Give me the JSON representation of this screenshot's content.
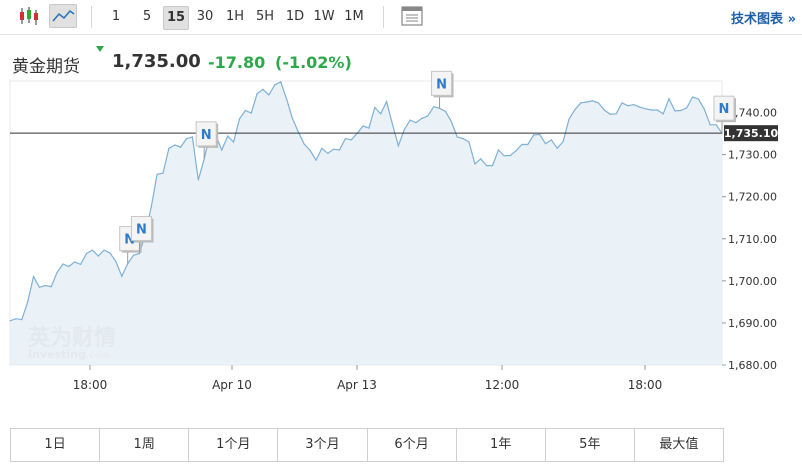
{
  "toolbar": {
    "intervals": [
      "1",
      "5",
      "15",
      "30",
      "1H",
      "5H",
      "1D",
      "1W",
      "1M"
    ],
    "active_interval": "15",
    "tech_chart_label": "技术图表",
    "tech_chart_arrow": "»"
  },
  "header": {
    "name": "黄金期货",
    "price": "1,735.00",
    "change": "-17.80",
    "change_pct": "(-1.02%)",
    "change_color": "#2da94a"
  },
  "watermark": {
    "cn": "英为财情",
    "en": "Investing",
    "suffix": ".com"
  },
  "range_buttons": [
    "1日",
    "1周",
    "1个月",
    "3个月",
    "6个月",
    "1年",
    "5年",
    "最大值"
  ],
  "chart_data": {
    "type": "area",
    "x_tick_labels": [
      "18:00",
      "Apr 10",
      "Apr 13",
      "12:00",
      "18:00"
    ],
    "y_ticks": [
      1680,
      1690,
      1700,
      1710,
      1720,
      1730,
      1740
    ],
    "y_tick_labels": [
      "1,680.00",
      "1,690.00",
      "1,700.00",
      "1,710.00",
      "1,720.00",
      "1,730.00",
      "1,740.00"
    ],
    "ylim": [
      1680,
      1747.5
    ],
    "current_price": 1735.1,
    "current_price_label": "1,735.10",
    "line_color": "#7eb1d7",
    "fill_color": "#e6eff6",
    "series": [
      {
        "values": [
          1690.5,
          1691,
          1690.8,
          1695,
          1701,
          1698.5,
          1698.9,
          1698.6,
          1702,
          1704,
          1703.4,
          1704.5,
          1703.9,
          1706.5,
          1707.3,
          1705.9,
          1707.3,
          1706.6,
          1704.6,
          1701.1,
          1704.1,
          1706.1,
          1706.5,
          1711.1,
          1717.5,
          1725.3,
          1725.6,
          1731.5,
          1732.3,
          1731.8,
          1733.8,
          1734.2,
          1724,
          1729,
          1735.1,
          1734.4,
          1731.1,
          1734.4,
          1733,
          1738.5,
          1740.5,
          1739.9,
          1744.5,
          1745.5,
          1744.2,
          1746.6,
          1747.3,
          1743.2,
          1738.6,
          1735.4,
          1732.5,
          1731,
          1728.7,
          1731.5,
          1730.3,
          1731.3,
          1731.1,
          1733.8,
          1733.5,
          1735.1,
          1736.8,
          1736.3,
          1741.2,
          1739.7,
          1742.6,
          1737.2,
          1732.1,
          1735.9,
          1738.2,
          1737.6,
          1738.6,
          1739.2,
          1741.4,
          1741,
          1740.3,
          1737.9,
          1734.2,
          1733.8,
          1733,
          1727.8,
          1729,
          1727.4,
          1727.4,
          1731.1,
          1729.7,
          1729.8,
          1730.9,
          1732.4,
          1732.4,
          1734.7,
          1734.8,
          1732.6,
          1733.5,
          1731.5,
          1733.1,
          1738.4,
          1740.7,
          1742.3,
          1742.5,
          1742.8,
          1742.3,
          1740.6,
          1739.6,
          1739.7,
          1742.3,
          1741.6,
          1741.9,
          1741.3,
          1740.9,
          1740.6,
          1740.6,
          1739.7,
          1743.3,
          1740.4,
          1740.5,
          1741.1,
          1743.7,
          1743.2,
          1740.8,
          1737.1,
          1737.1,
          1735.1
        ]
      }
    ],
    "news_markers": [
      {
        "index": 20,
        "label": "N"
      },
      {
        "index": 22,
        "label": "N"
      },
      {
        "index": 33,
        "label": "N"
      },
      {
        "index": 73,
        "label": "N"
      },
      {
        "index": 121,
        "label": "N"
      }
    ]
  }
}
